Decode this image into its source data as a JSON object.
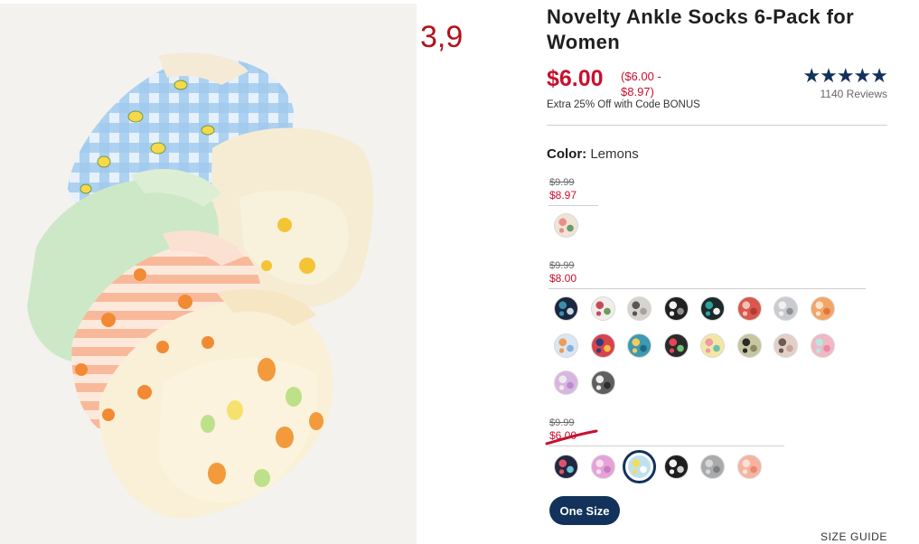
{
  "annotation": "3,9",
  "product": {
    "title": "Novelty Ankle Socks 6-Pack for Women",
    "price_current": "$6.00",
    "price_range": "($6.00 - $8.97)",
    "promo": "Extra 25% Off with Code BONUS",
    "rating": {
      "stars": "★★★★★",
      "reviews": "1140 Reviews",
      "value": 5
    },
    "color_label": "Color:",
    "color_value": "Lemons"
  },
  "swatch_groups": [
    {
      "original_price": "$9.99",
      "sale_price": "$8.97",
      "swatches": [
        {
          "name": "floral-cream",
          "colors": [
            "#efe4d6",
            "#e98f8a",
            "#6f9a6b"
          ]
        }
      ]
    },
    {
      "original_price": "$9.99",
      "sale_price": "$8.00",
      "swatches": [
        {
          "name": "navy-print",
          "colors": [
            "#1b2740",
            "#3a8fa8",
            "#c7d6e0"
          ]
        },
        {
          "name": "white-floral",
          "colors": [
            "#f1eeea",
            "#c84b5c",
            "#6d9b5b"
          ]
        },
        {
          "name": "grey-birds",
          "colors": [
            "#d7d3ce",
            "#5a5556",
            "#a8a29d"
          ]
        },
        {
          "name": "black-ghost",
          "colors": [
            "#202020",
            "#f1f1f1",
            "#8f8f8f"
          ]
        },
        {
          "name": "teal-stripe",
          "colors": [
            "#1c2a2b",
            "#2aa39c",
            "#f1f1f1"
          ]
        },
        {
          "name": "red-dots",
          "colors": [
            "#d8584d",
            "#f1c0b7",
            "#b53a31"
          ]
        },
        {
          "name": "grey-speckle",
          "colors": [
            "#c9cbcf",
            "#f1f1f1",
            "#8e9095"
          ]
        },
        {
          "name": "orange-swirl",
          "colors": [
            "#f3a566",
            "#fbe4cc",
            "#e2753f"
          ]
        },
        {
          "name": "blue-fruit",
          "colors": [
            "#d9e6f3",
            "#f29a55",
            "#8ab0d9"
          ]
        },
        {
          "name": "rainbow-stripe",
          "colors": [
            "#d8434d",
            "#2f3d7a",
            "#f6c043"
          ]
        },
        {
          "name": "teal-fish",
          "colors": [
            "#3d9ab0",
            "#f6ca5b",
            "#1f6b80"
          ]
        },
        {
          "name": "watermelon",
          "colors": [
            "#2a2a2a",
            "#e2445a",
            "#6ec072"
          ]
        },
        {
          "name": "flamingo",
          "colors": [
            "#f3e7a3",
            "#f09aaa",
            "#6fc2ad"
          ]
        },
        {
          "name": "olive-leopard",
          "colors": [
            "#c7c6a1",
            "#2a2a2a",
            "#8a8a64"
          ]
        },
        {
          "name": "pink-leopard",
          "colors": [
            "#e4cfc6",
            "#6b5a55",
            "#c4a69b"
          ]
        },
        {
          "name": "pink-tiedye",
          "colors": [
            "#f0b8c4",
            "#b8e6e4",
            "#e68aa6"
          ]
        },
        {
          "name": "lavender-swirl",
          "colors": [
            "#d9b6e0",
            "#eeeaf0",
            "#b98ad0"
          ]
        },
        {
          "name": "grey-zebra",
          "colors": [
            "#5f5f5f",
            "#ececec",
            "#2e2e2e"
          ]
        }
      ]
    },
    {
      "original_price": "$9.99",
      "sale_price": "$6.00",
      "swatches": [
        {
          "name": "navy-confetti",
          "colors": [
            "#1f2940",
            "#e0506b",
            "#6cc0d8"
          ]
        },
        {
          "name": "pink-swirl",
          "colors": [
            "#e6a2d8",
            "#f6e0ef",
            "#c77dc2"
          ]
        },
        {
          "name": "lemons",
          "colors": [
            "#bfe0f0",
            "#f2dd55",
            "#ffffff"
          ],
          "selected": true
        },
        {
          "name": "black-daisy",
          "colors": [
            "#1e1e1e",
            "#f1f1f1",
            "#d0d0d0"
          ]
        },
        {
          "name": "grey-heather",
          "colors": [
            "#a9aaab",
            "#d7d7d7",
            "#7e7f80"
          ]
        },
        {
          "name": "peach-floral",
          "colors": [
            "#f6b4a0",
            "#fbe2d8",
            "#e48a77"
          ]
        }
      ]
    }
  ],
  "size_button": "One Size",
  "size_guide": "SIZE GUIDE",
  "theme": {
    "sale_red": "#c8102e",
    "navy": "#12325b"
  }
}
